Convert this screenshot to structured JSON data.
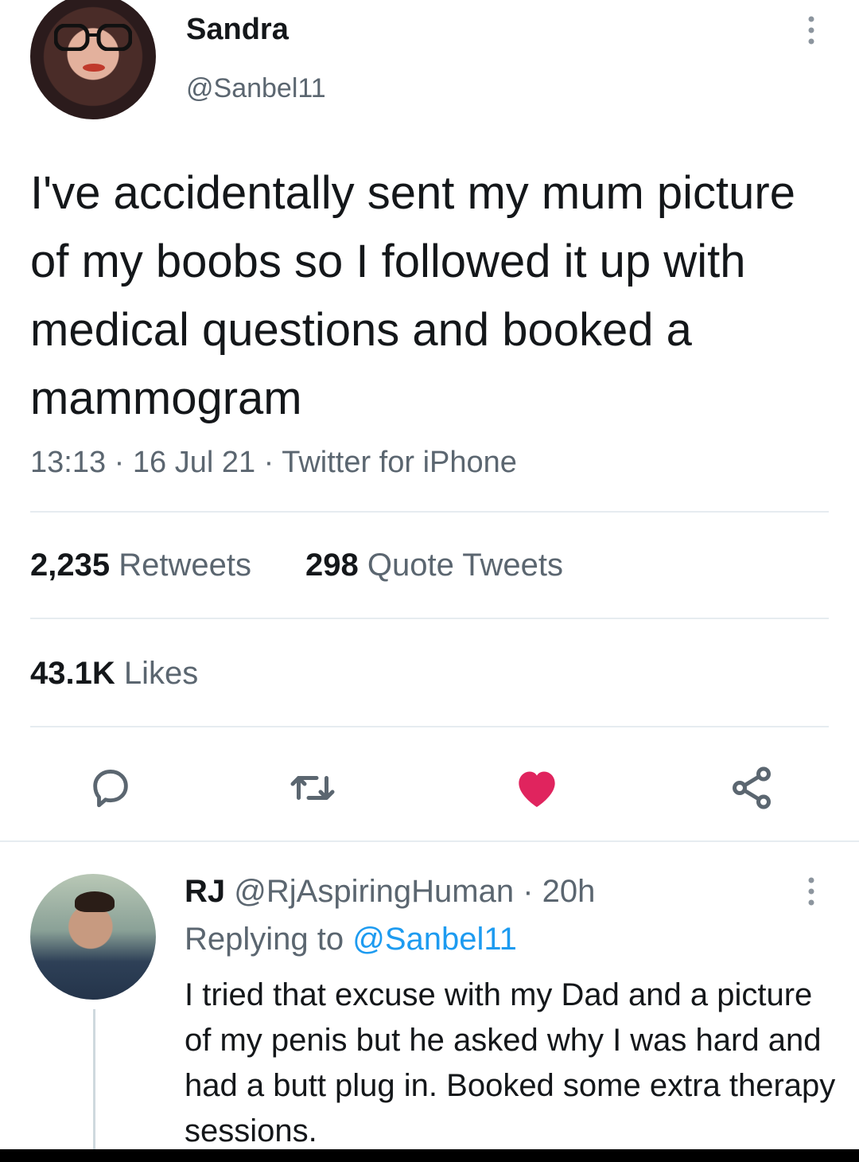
{
  "tweet": {
    "author_name": "Sandra",
    "author_handle": "@Sanbel11",
    "more_icon": "more-vertical-icon",
    "text": "I've accidentally sent my mum picture of my boobs so I followed it up with medical questions and booked a mammogram",
    "time": "13:13",
    "date": "16 Jul 21",
    "source": "Twitter for iPhone",
    "separator": " · ",
    "stats": {
      "retweets_count": "2,235",
      "retweets_label": "Retweets",
      "quotes_count": "298",
      "quotes_label": "Quote Tweets",
      "likes_count": "43.1K",
      "likes_label": "Likes"
    },
    "actions": {
      "reply_icon": "reply-icon",
      "retweet_icon": "retweet-icon",
      "like_icon": "heart-icon",
      "share_icon": "share-icon",
      "liked": true,
      "like_color": "#e0245e"
    }
  },
  "reply": {
    "author_name": "RJ",
    "author_handle": "@RjAspiringHuman",
    "age": "20h",
    "replying_label": "Replying to",
    "replying_to": "@Sanbel11",
    "text": "I tried that excuse with my Dad and a picture of my penis but he asked why I was hard and had a butt plug in. Booked some extra therapy sessions."
  },
  "colors": {
    "text_primary": "#14171a",
    "text_secondary": "#5b6670",
    "link": "#1d9bf0",
    "divider": "#e6ecf0"
  }
}
